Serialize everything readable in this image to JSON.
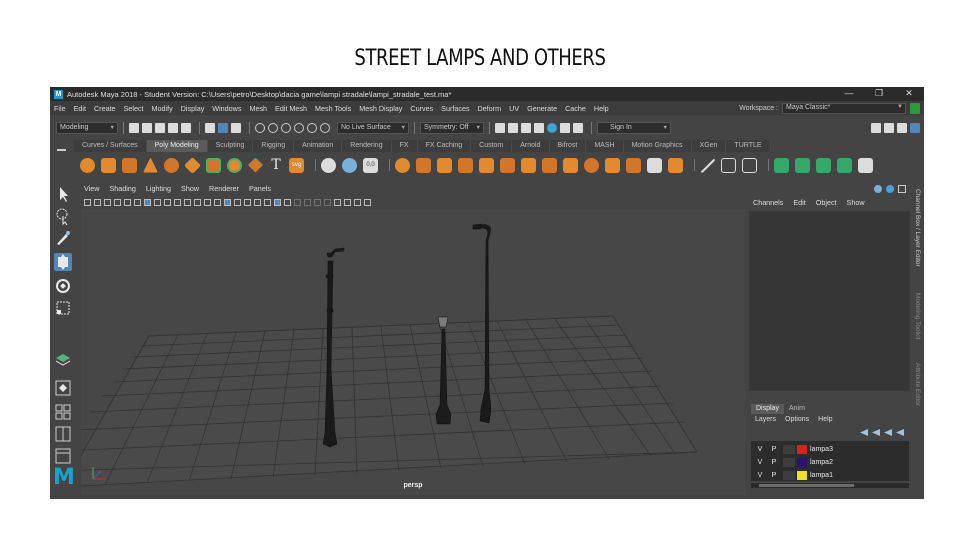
{
  "slide": {
    "title": "STREET LAMPS AND OTHERS"
  },
  "window": {
    "title": "Autodesk Maya 2018 - Student Version: C:\\Users\\petro\\Desktop\\dacia game\\lampi stradale\\lampi_stradale_test.ma*",
    "controls": [
      "—",
      "❐",
      "✕"
    ]
  },
  "menubar": [
    "File",
    "Edit",
    "Create",
    "Select",
    "Modify",
    "Display",
    "Windows",
    "Mesh",
    "Edit Mesh",
    "Mesh Tools",
    "Mesh Display",
    "Curves",
    "Surfaces",
    "Deform",
    "UV",
    "Generate",
    "Cache",
    "Help"
  ],
  "workspace": {
    "label": "Workspace :",
    "value": "Maya Classic*"
  },
  "statusline": {
    "menuset": "Modeling",
    "live_surface": "No Live Surface",
    "symmetry": "Symmetry: Off",
    "signin": "Sign In"
  },
  "shelf_tabs": [
    "Curves / Surfaces",
    "Poly Modeling",
    "Sculpting",
    "Rigging",
    "Animation",
    "Rendering",
    "FX",
    "FX Caching",
    "Custom",
    "Arnold",
    "Bifrost",
    "MASH",
    "Motion Graphics",
    "XGen",
    "TURTLE"
  ],
  "shelf_active": "Poly Modeling",
  "shelf_icons": [
    "sphere",
    "cube",
    "cylinder",
    "cone",
    "torus",
    "plane",
    "combine",
    "separate",
    "smooth",
    "boolean",
    "text",
    "svg",
    "sculpt",
    "uv",
    "bevel",
    "bridge",
    "extrude",
    "insert-loop",
    "multi-cut",
    "target-weld",
    "merge",
    "collapse",
    "fill-hole",
    "triangulate",
    "quadrangulate",
    "mirror",
    "uv-editor",
    "camera-based",
    "automatic"
  ],
  "viewport": {
    "menu": [
      "View",
      "Shading",
      "Lighting",
      "Show",
      "Renderer",
      "Panels"
    ],
    "camera_label": "persp"
  },
  "channel_box": {
    "menu": [
      "Channels",
      "Edit",
      "Object",
      "Show"
    ]
  },
  "layer_editor": {
    "tabs": [
      "Display",
      "Anim"
    ],
    "active_tab": "Display",
    "menu": [
      "Layers",
      "Options",
      "Help"
    ],
    "layers": [
      {
        "v": "V",
        "p": "P",
        "name": "lampa3",
        "color": "#e0201c"
      },
      {
        "v": "V",
        "p": "P",
        "name": "lampa2",
        "color": "#2a1470"
      },
      {
        "v": "V",
        "p": "P",
        "name": "lampa1",
        "color": "#f0e020"
      }
    ]
  },
  "side_tabs": [
    "Channel Box / Layer Editor",
    "Modeling Toolkit",
    "Attribute Editor"
  ],
  "logo": "M"
}
